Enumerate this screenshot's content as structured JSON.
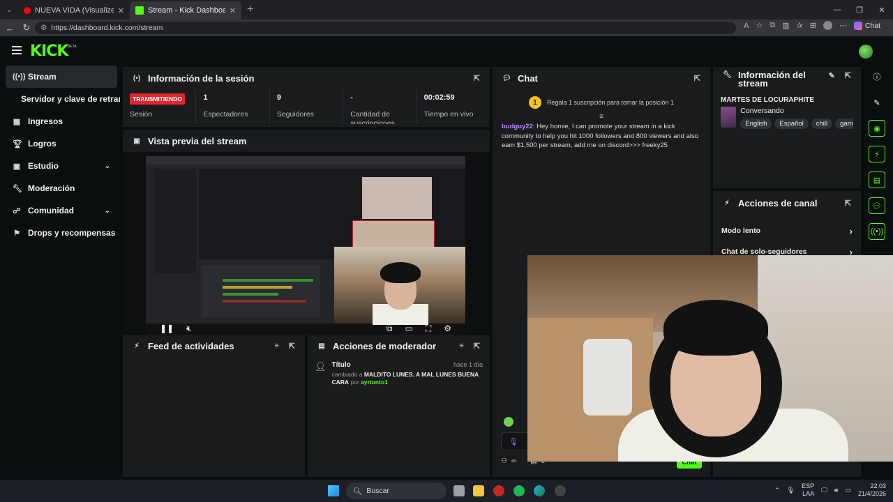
{
  "browser": {
    "tabs": [
      {
        "title": "NUEVA VIDA (Visualizer) - Peso Pl",
        "active": false,
        "favicon_color": "#ff0000"
      },
      {
        "title": "Stream - Kick Dashboard",
        "active": true,
        "favicon_color": "#53fc18"
      }
    ],
    "url": "https://dashboard.kick.com/stream",
    "chat_extension": "Chat"
  },
  "brand": {
    "logo": "KICK",
    "beta": "BETA",
    "accent": "#53fc18"
  },
  "sidebar": {
    "items": [
      {
        "label": "Stream",
        "icon": "broadcast-icon",
        "active": true
      },
      {
        "label": "Servidor y clave de retransm",
        "icon": "",
        "active": false
      },
      {
        "label": "Ingresos",
        "icon": "chart-icon",
        "active": false
      },
      {
        "label": "Logros",
        "icon": "trophy-icon",
        "active": false
      },
      {
        "label": "Estudio",
        "icon": "studio-icon",
        "active": false,
        "expandable": true
      },
      {
        "label": "Moderación",
        "icon": "wrench-icon",
        "active": false
      },
      {
        "label": "Comunidad",
        "icon": "community-icon",
        "active": false,
        "expandable": true
      },
      {
        "label": "Drops y recompensas",
        "icon": "rewards-icon",
        "active": false
      }
    ]
  },
  "session": {
    "title": "Información de la sesión",
    "badge": "TRANSMITIENDO",
    "badge_label": "Sesión",
    "stats": [
      {
        "value": "1",
        "label": "Espectadores"
      },
      {
        "value": "9",
        "label": "Seguidores"
      },
      {
        "value": "-",
        "label": "Cantidad de suscripciones"
      },
      {
        "value": "00:02:59",
        "label": "Tiempo en vivo"
      }
    ]
  },
  "preview": {
    "title": "Vista previa del stream"
  },
  "activity": {
    "title": "Feed de actividades"
  },
  "modactions": {
    "title": "Acciones de moderador",
    "entry": {
      "kind": "Título",
      "time": "hace 1 día",
      "prefix": "cambiado a",
      "value": "MALDITO LUNES. A MAL LUNES BUENA CARA",
      "by": "por",
      "user": "ayrtonto1"
    }
  },
  "chat": {
    "title": "Chat",
    "gift_rank": "1",
    "gift_note": "Regala 1 suscripción para tomar la posición 1",
    "message": {
      "user": "budguy22",
      "text": "Hey homie, I can promote your stream in a kick community to help you hit 1000 followers and 800 viewers and also earn $1,500 per stream, add me on discord>>> freeky25"
    },
    "count": "0",
    "send": "Chat"
  },
  "streaminfo": {
    "title": "Información del stream",
    "stream_title": "MARTES DE LOCURAPHITE",
    "category": "Conversando",
    "tags": [
      "English",
      "Español",
      "chill",
      "gami"
    ]
  },
  "channelactions": {
    "title": "Acciones de canal",
    "items": [
      "Modo lento",
      "Chat de solo-seguidores"
    ]
  },
  "taskbar": {
    "search": "Buscar",
    "lang1": "ESP",
    "lang2": "LAA",
    "time": "22:03",
    "date": "21/4/2026"
  }
}
